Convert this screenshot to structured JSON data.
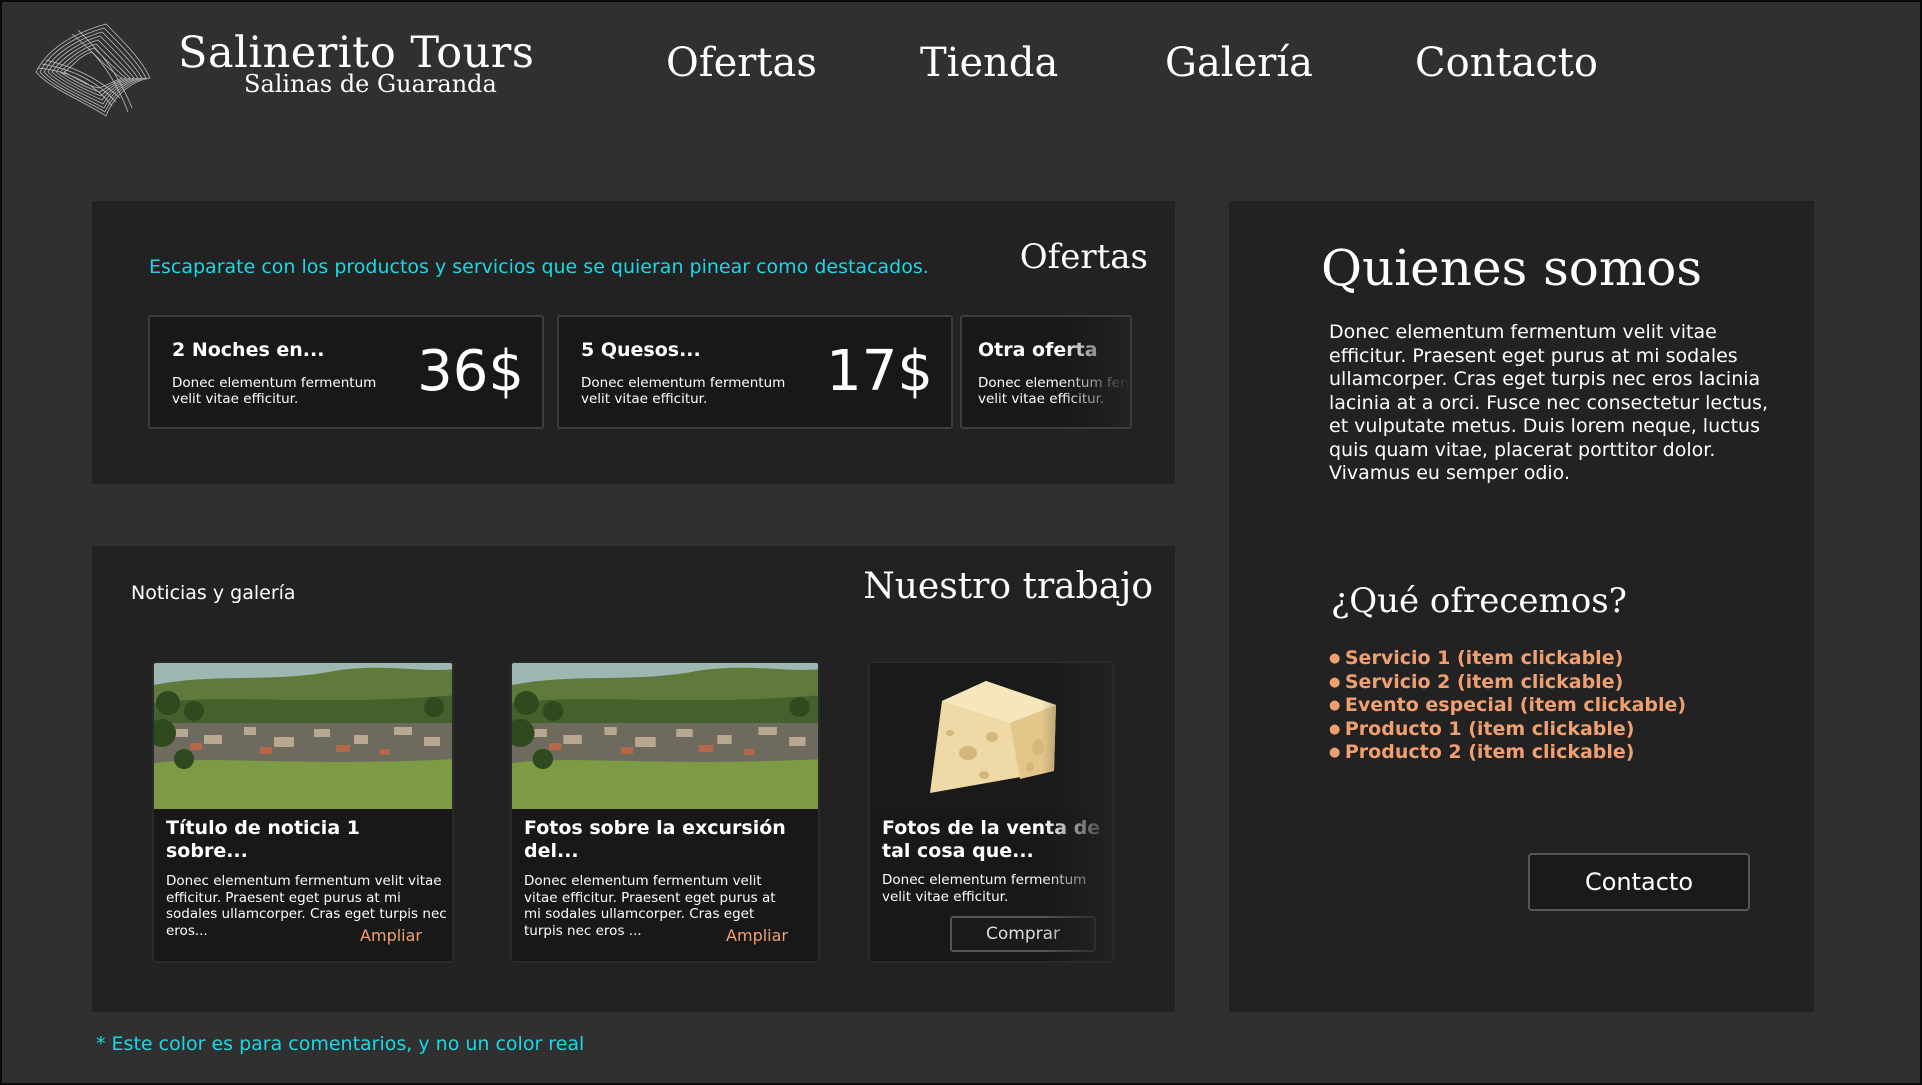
{
  "brand": {
    "title": "Salinerito Tours",
    "subtitle": "Salinas de Guaranda",
    "logo_icon": "wave-ribbon-logo-icon"
  },
  "nav": {
    "items": [
      {
        "label": "Ofertas"
      },
      {
        "label": "Tienda"
      },
      {
        "label": "Galería"
      },
      {
        "label": "Contacto"
      }
    ]
  },
  "offers": {
    "heading": "Ofertas",
    "comment": "Escaparate con los productos y servicios que se quieran pinear como destacados.",
    "cards": [
      {
        "title": "2 Noches en...",
        "desc": "Donec elementum fermentum velit vitae efficitur.",
        "price": "36$"
      },
      {
        "title": "5 Quesos...",
        "desc": "Donec elementum fermentum velit vitae efficitur.",
        "price": "17$"
      },
      {
        "title": "Otra oferta",
        "desc": "Donec elementum fermentum velit vitae efficitur."
      }
    ]
  },
  "work": {
    "heading": "Nuestro trabajo",
    "label": "Noticias y galería",
    "cards": [
      {
        "title": "Título de noticia 1 sobre...",
        "desc": "Donec elementum fermentum velit vitae efficitur. Praesent eget purus at mi sodales ullamcorper. Cras eget turpis nec eros...",
        "link": "Ampliar",
        "image": "village-landscape-photo"
      },
      {
        "title": "Fotos sobre la excursión del...",
        "desc": "Donec elementum fermentum velit vitae efficitur. Praesent eget purus at mi sodales ullamcorper. Cras eget turpis nec eros ...",
        "link": "Ampliar",
        "image": "village-landscape-photo"
      },
      {
        "title": "Fotos de la venta de tal cosa que...",
        "desc": "Donec elementum fermentum velit vitae efficitur.",
        "button": "Comprar",
        "image": "cheese-wedge-photo"
      }
    ]
  },
  "about": {
    "title": "Quienes somos",
    "text": "Donec elementum fermentum velit vitae efficitur. Praesent eget purus at mi sodales ullamcorper. Cras eget turpis nec eros lacinia lacinia at a orci. Fusce nec consectetur lectus, et vulputate metus. Duis lorem neque, luctus quis quam vitae, placerat porttitor dolor. Vivamus eu semper odio.",
    "services_heading": "¿Qué ofrecemos?",
    "services": [
      "Servicio 1 (item clickable)",
      "Servicio 2 (item clickable)",
      "Evento especial (item clickable)",
      "Producto 1 (item clickable)",
      "Producto 2 (item clickable)"
    ],
    "contact_button": "Contacto"
  },
  "footnote": "* Este color es para comentarios, y no un color real",
  "colors": {
    "background": "#303030",
    "panel": "#222222",
    "card": "#181818",
    "comment": "#1ad8e6",
    "accent": "#f0a070"
  }
}
